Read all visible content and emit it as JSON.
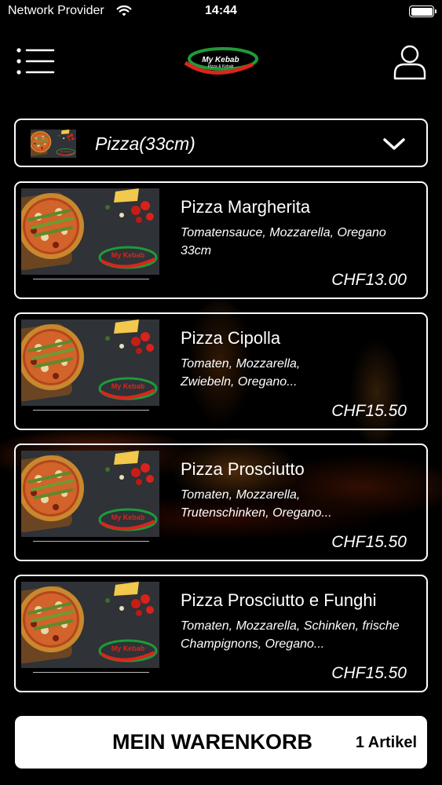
{
  "status_bar": {
    "carrier": "Network Provider",
    "time": "14:44",
    "wifi_icon": "wifi-icon",
    "battery_icon": "battery-icon"
  },
  "header": {
    "menu_icon": "menu-list-icon",
    "logo": {
      "name": "My Kebab",
      "tagline": "Pizza & Kebab"
    },
    "user_icon": "user-icon"
  },
  "category": {
    "selected": "Pizza(33cm)",
    "dropdown_icon": "chevron-down-icon"
  },
  "products": [
    {
      "title": "Pizza Margherita",
      "description": "Tomatensauce, Mozzarella, Oregano 33cm",
      "price": "CHF13.00"
    },
    {
      "title": "Pizza Cipolla",
      "description": "Tomaten, Mozzarella, Zwiebeln, Oregano...",
      "price": "CHF15.50"
    },
    {
      "title": "Pizza Prosciutto",
      "description": "Tomaten, Mozzarella, Trutenschinken, Oregano...",
      "price": "CHF15.50"
    },
    {
      "title": "Pizza Prosciutto e Funghi",
      "description": "Tomaten, Mozzarella, Schinken, frische Champignons, Oregano...",
      "price": "CHF15.50"
    }
  ],
  "cart": {
    "label": "MEIN WARENKORB",
    "count": "1 Artikel"
  },
  "colors": {
    "background": "#000000",
    "logo_green": "#1e9a3a",
    "logo_red": "#d9261c",
    "cart_bg": "#ffffff"
  }
}
